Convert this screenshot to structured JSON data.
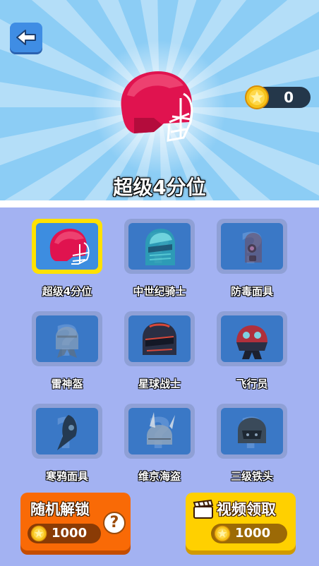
{
  "hero": {
    "name": "超级4分位"
  },
  "coins": {
    "count": "0"
  },
  "items": [
    {
      "name": "超级4分位",
      "selected": true,
      "locked": false,
      "icon": "football-helmet-red-icon"
    },
    {
      "name": "中世纪骑士",
      "selected": false,
      "locked": true,
      "icon": "knight-helmet-icon"
    },
    {
      "name": "防毒面具",
      "selected": false,
      "locked": true,
      "icon": "gas-mask-icon"
    },
    {
      "name": "雷神盔",
      "selected": false,
      "locked": true,
      "icon": "thor-helmet-icon"
    },
    {
      "name": "星球战士",
      "selected": false,
      "locked": true,
      "icon": "space-warrior-helmet-icon"
    },
    {
      "name": "飞行员",
      "selected": false,
      "locked": true,
      "icon": "pilot-helmet-icon"
    },
    {
      "name": "寒鸦面具",
      "selected": false,
      "locked": true,
      "icon": "plague-mask-icon"
    },
    {
      "name": "维京海盗",
      "selected": false,
      "locked": true,
      "icon": "viking-helmet-icon"
    },
    {
      "name": "三级铁头",
      "selected": false,
      "locked": true,
      "icon": "level3-helmet-icon"
    }
  ],
  "actions": {
    "random_unlock": {
      "label": "随机解锁",
      "cost": "1000"
    },
    "video_claim": {
      "label": "视频领取",
      "cost": "1000"
    },
    "help": "?"
  },
  "colors": {
    "sky": "#8ccdf5",
    "panel": "#a3b2f2",
    "selected": "#ffe100",
    "orange": "#f96a06",
    "yellow": "#ffd000"
  }
}
